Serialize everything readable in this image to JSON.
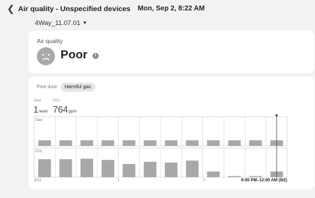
{
  "header": {
    "title": "Air quality - Unspecified devices",
    "datetime": "Mon, Sep 2, 8:22 AM"
  },
  "device": {
    "name": "4Way_11.07.01"
  },
  "air_quality": {
    "label": "Air quality",
    "status": "Poor"
  },
  "tabs": [
    "Fine dust",
    "Harmful gas"
  ],
  "selected_tab": "Harmful gas",
  "metrics": {
    "gas": {
      "label": "Gas",
      "value": "1",
      "unit": "level"
    },
    "co2": {
      "label": "CO₂",
      "value": "764",
      "unit": "ppm"
    }
  },
  "chart_data": {
    "type": "bar",
    "panels": [
      {
        "label": "Gas",
        "values": [
          1,
          1,
          1,
          1,
          1,
          1,
          1,
          1,
          1,
          1,
          1,
          1
        ],
        "ylim": [
          0,
          4.2
        ]
      },
      {
        "label": "CO₂",
        "values": [
          760,
          760,
          780,
          730,
          560,
          650,
          620,
          700,
          240,
          20,
          20,
          240
        ],
        "ylim": [
          0,
          1000
        ]
      }
    ],
    "x_labels": [
      "8/31",
      "1",
      "2"
    ],
    "range_label": "6:00 PM–12:00 AM (9/2)",
    "colors": {
      "bar": "#a8a8a8",
      "grid": "#d4d4d4",
      "cursor": "#444444"
    }
  }
}
